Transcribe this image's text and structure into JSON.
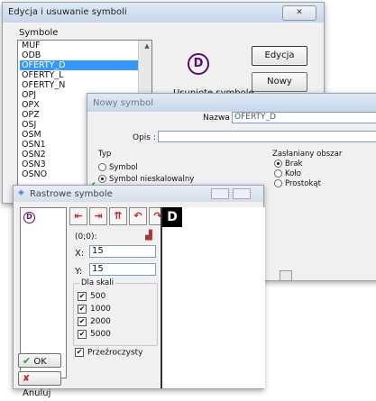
{
  "dlg_edycja": {
    "title": "Edycja i usuwanie symboli",
    "close": "✕",
    "group_label": "Symbole",
    "list_items": [
      "MUF",
      "ODB",
      "OFERTY_D",
      "OFERTY_L",
      "OFERTY_N",
      "OPJ",
      "OPX",
      "OPZ",
      "OSJ",
      "OSM",
      "OSN1",
      "OSN2",
      "OSN3",
      "OSNO"
    ],
    "selected_index": 2,
    "preview_symbol": "D",
    "edit_btn": "Edycja",
    "new_btn": "Nowy",
    "removed_label": "Usunięte symbole"
  },
  "dlg_nowy": {
    "title": "Nowy symbol",
    "nazwa_label": "Nazwa :",
    "nazwa_value": "OFERTY_D",
    "opis_label": "Opis :",
    "typ_label": "Typ",
    "typ_options": [
      "Symbol",
      "Symbol nieskalowalny"
    ],
    "typ_selected": 1,
    "obszar_label": "Zasłaniany obszar",
    "obszar_options": [
      "Brak",
      "Koło",
      "Prostokąt"
    ],
    "obszar_selected": 0,
    "checkmark": "✔"
  },
  "dlg_raster": {
    "title": "Rastrowe symbole",
    "list_symbol": "D",
    "coord_text": "(0;0):",
    "x_label": "X:",
    "x_value": "15",
    "y_label": "Y:",
    "y_value": "15",
    "scale_label": "Dla skali",
    "scales": [
      "500",
      "1000",
      "2000",
      "5000"
    ],
    "transparent_label": "Przeźroczysty",
    "ok_label": "OK",
    "cancel_label": "Anuluj",
    "preview_letter": "D",
    "check": "✔",
    "cross": "✘",
    "tools": [
      "left-arrow-icon",
      "right-arrow-icon",
      "up-arrow-icon",
      "undo-icon",
      "redo-icon"
    ]
  },
  "colors": {
    "accent": "#3399ff",
    "symbol": "#5b0a6e",
    "ok_green": "#2e9b2e",
    "cancel_red": "#cc1b1b"
  }
}
